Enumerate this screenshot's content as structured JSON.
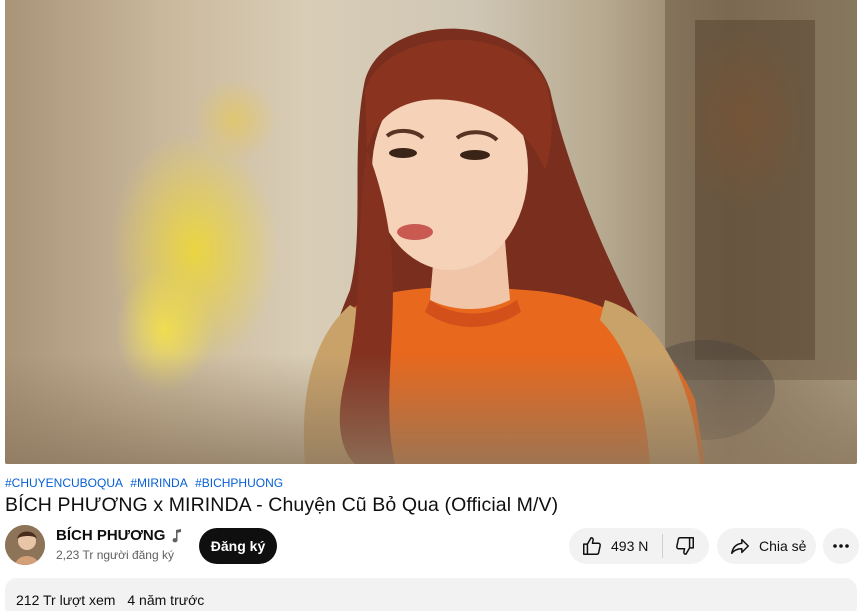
{
  "video": {
    "hashtags": [
      "#CHUYENCUBOQUA",
      "#MIRINDA",
      "#BICHPHUONG"
    ],
    "title": "BÍCH PHƯƠNG x MIRINDA - Chuyện Cũ Bỏ Qua (Official M/V)"
  },
  "channel": {
    "name": "BÍCH PHƯƠNG",
    "badge_icon": "music-note-icon",
    "subscribers": "2,23 Tr người đăng ký"
  },
  "actions": {
    "subscribe_label": "Đăng ký",
    "like_count": "493 N",
    "like_icon": "thumbs-up-icon",
    "dislike_icon": "thumbs-down-icon",
    "share_label": "Chia sẻ",
    "share_icon": "share-arrow-icon",
    "more_icon": "more-horizontal-icon"
  },
  "description": {
    "views": "212 Tr lượt xem",
    "published": "4 năm trước"
  },
  "colors": {
    "link": "#065fd4",
    "subscribe_bg": "#0f0f0f",
    "pill_bg": "#f2f2f2",
    "secondary_text": "#606060"
  }
}
